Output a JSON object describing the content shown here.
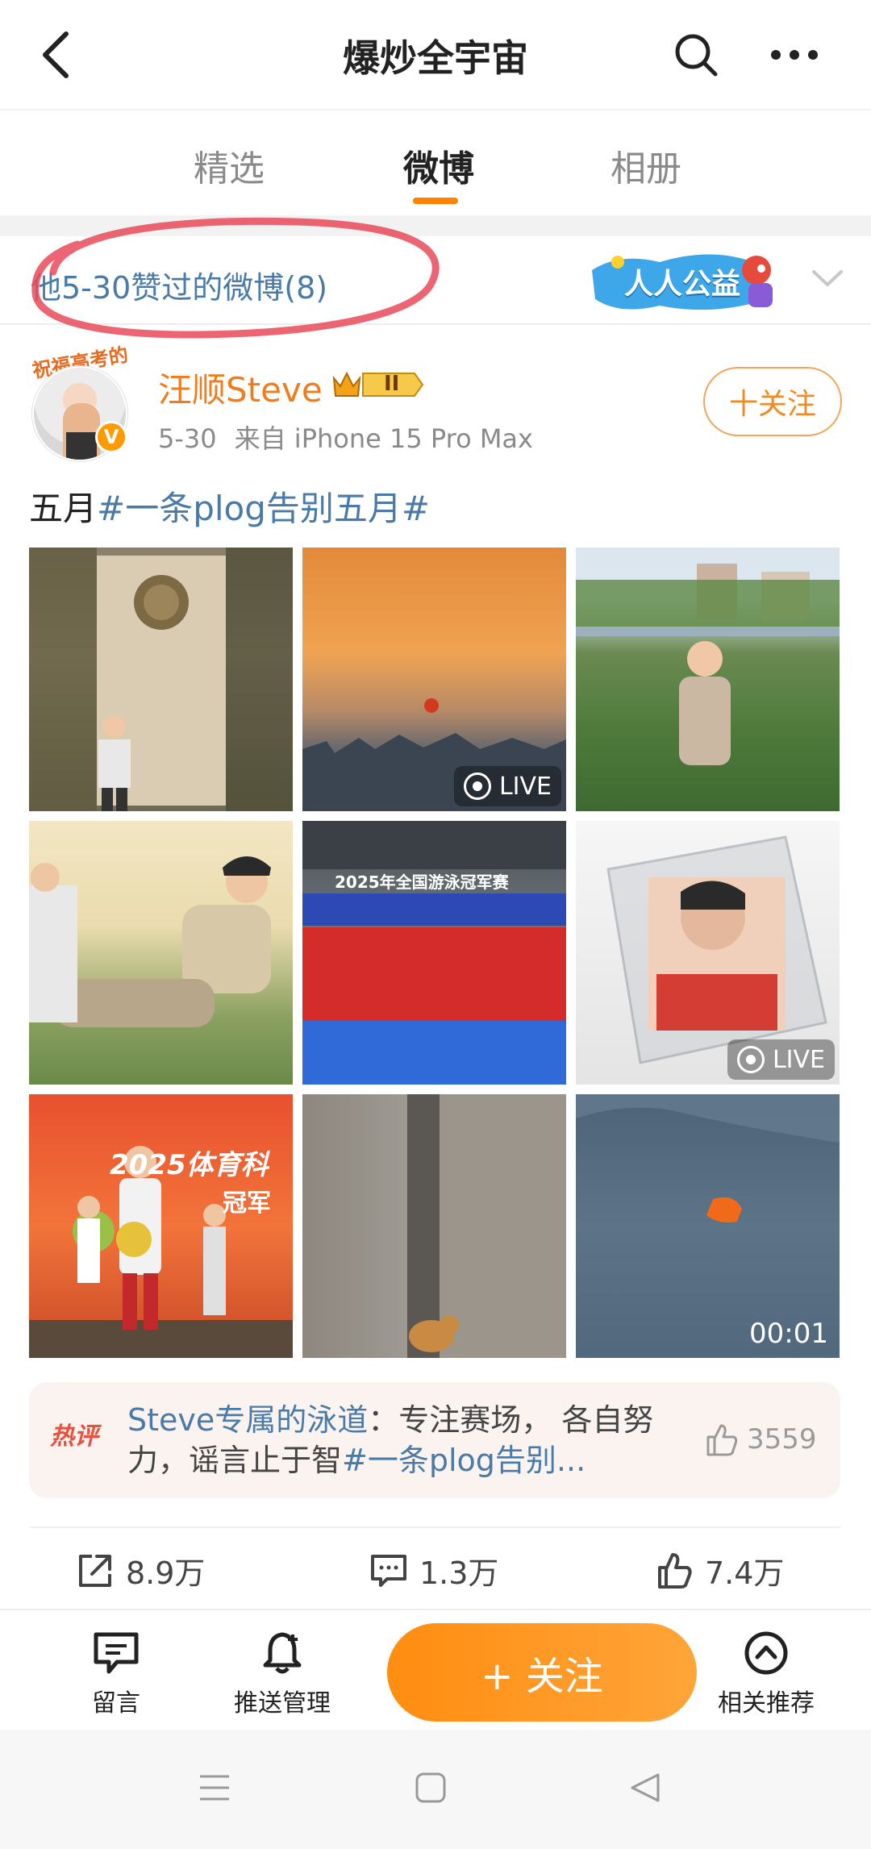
{
  "header": {
    "title": "爆炒全宇宙",
    "back_icon": "back-arrow-icon",
    "search_icon": "search-icon",
    "more_icon": "more-icon"
  },
  "tabs": [
    {
      "label": "精选",
      "active": false
    },
    {
      "label": "微博",
      "active": true
    },
    {
      "label": "相册",
      "active": false
    }
  ],
  "liked_header": {
    "label": "他5-30赞过的微博(8)",
    "promo_text": "人人公益"
  },
  "post": {
    "avatar_banner": "祝福高考的",
    "username": "汪顺Steve",
    "level_badge": "II",
    "date": "5-30",
    "source": "来自 iPhone 15 Pro Max",
    "follow_label": "十关注",
    "text_prefix": "五月",
    "text_tag": "#一条plog告别五月#",
    "live_label": "LIVE",
    "video_duration": "00:01",
    "images": [
      {
        "name": "stone-monument-photo"
      },
      {
        "name": "sunset-photo"
      },
      {
        "name": "lotus-pond-photo"
      },
      {
        "name": "sitting-on-grass-photo"
      },
      {
        "name": "championship-group-photo"
      },
      {
        "name": "crystal-photo"
      },
      {
        "name": "award-stage-photo"
      },
      {
        "name": "alley-dog-photo"
      },
      {
        "name": "orange-shoe-video"
      }
    ],
    "grid_text": {
      "championship": "2025年全国游泳冠军赛",
      "stage": "2025体育科",
      "stage_sub": "冠军"
    }
  },
  "hot_comment": {
    "tag": "热评",
    "author": "Steve专属的泳道",
    "text": "：专注赛场， 各自努力，谣言止于智",
    "tag_text": "#一条plog告别...",
    "likes": "3559"
  },
  "actions": {
    "repost": "8.9万",
    "comment": "1.3万",
    "like": "7.4万"
  },
  "bottom_bar": {
    "message": "留言",
    "push": "推送管理",
    "follow": "+ 关注",
    "related": "相关推荐"
  },
  "colors": {
    "accent": "#ff8200",
    "link": "#4a7aa8",
    "username": "#f07c1e"
  }
}
